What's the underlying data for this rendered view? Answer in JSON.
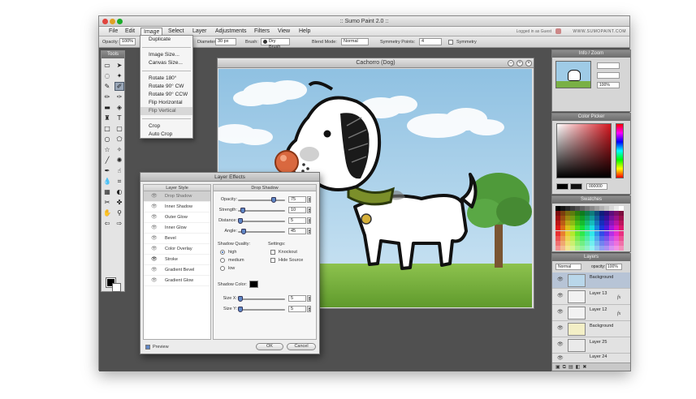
{
  "app": {
    "title": ":: Sumo Paint 2.0 ::",
    "user_info": "Logged in as Guest",
    "brand": "WWW.SUMOPAINT.COM"
  },
  "menu": {
    "items": [
      "File",
      "Edit",
      "Image",
      "Select",
      "Layer",
      "Adjustments",
      "Filters",
      "View",
      "Help"
    ],
    "active": "Image"
  },
  "options": {
    "opacity_label": "Opacity:",
    "opacity_value": "100%",
    "diameter_label": "Diameter:",
    "diameter_value": "30 px",
    "brush_label": "Brush:",
    "brush_value": "Dry Brush",
    "blend_label": "Blend Mode:",
    "blend_value": "Normal",
    "symmetry_points_label": "Symmetry Points:",
    "symmetry_points_value": "4",
    "symmetry_label": "Symmetry"
  },
  "tools": {
    "title": "Tools"
  },
  "image_menu": {
    "items": [
      "Duplicate",
      "Image Size...",
      "Canvas Size...",
      "Rotate 180°",
      "Rotate 90° CW",
      "Rotate 90° CCW",
      "Flip Horizontal",
      "Flip Vertical",
      "Crop",
      "Auto Crop"
    ],
    "highlighted": "Flip Vertical"
  },
  "canvas": {
    "title": "Cachorro (Dog)"
  },
  "info_panel": {
    "title": "Info / Zoom",
    "zoom_value": "100%"
  },
  "color_picker": {
    "title": "Color Picker",
    "hex_value": "000000",
    "accent": "#d51820"
  },
  "swatches": {
    "title": "Swatches"
  },
  "layers": {
    "title": "Layers",
    "blend_value": "Normal",
    "opacity_label": "opacity:",
    "opacity_value": "100%",
    "items": [
      {
        "name": "Background",
        "fx": false
      },
      {
        "name": "Layer 13",
        "fx": true
      },
      {
        "name": "Layer 12",
        "fx": true
      },
      {
        "name": "Background",
        "fx": false
      },
      {
        "name": "Layer 25",
        "fx": false
      },
      {
        "name": "Layer 24",
        "fx": false
      }
    ]
  },
  "layer_effects": {
    "title": "Layer Effects",
    "style_header": "Layer Style",
    "styles": [
      "Drop Shadow",
      "Inner Shadow",
      "Outer Glow",
      "Inner Glow",
      "Bevel",
      "Color Overlay",
      "Stroke",
      "Gradient Bevel",
      "Gradient Glow"
    ],
    "selected_style": "Drop Shadow",
    "section_header": "Drop Shadow",
    "opacity": {
      "label": "Opacity:",
      "value": "75",
      "level": 0.75
    },
    "strength": {
      "label": "Strength:",
      "value": "10",
      "level": 0.1
    },
    "distance": {
      "label": "Distance:",
      "value": "5",
      "level": 0.05
    },
    "angle": {
      "label": "Angle:",
      "value": "45",
      "level": 0.125
    },
    "quality_label": "Shadow Quality:",
    "quality_options": [
      "high",
      "medium",
      "low"
    ],
    "quality_selected": "high",
    "settings_label": "Settings:",
    "knockout_label": "Knockout",
    "hide_source_label": "Hide Source",
    "shadow_color_label": "Shadow Color:",
    "size_x": {
      "label": "Size X:",
      "value": "5",
      "level": 0.05
    },
    "size_y": {
      "label": "Size Y:",
      "value": "5",
      "level": 0.05
    },
    "preview_label": "Preview",
    "ok_label": "OK",
    "cancel_label": "Cancel"
  }
}
